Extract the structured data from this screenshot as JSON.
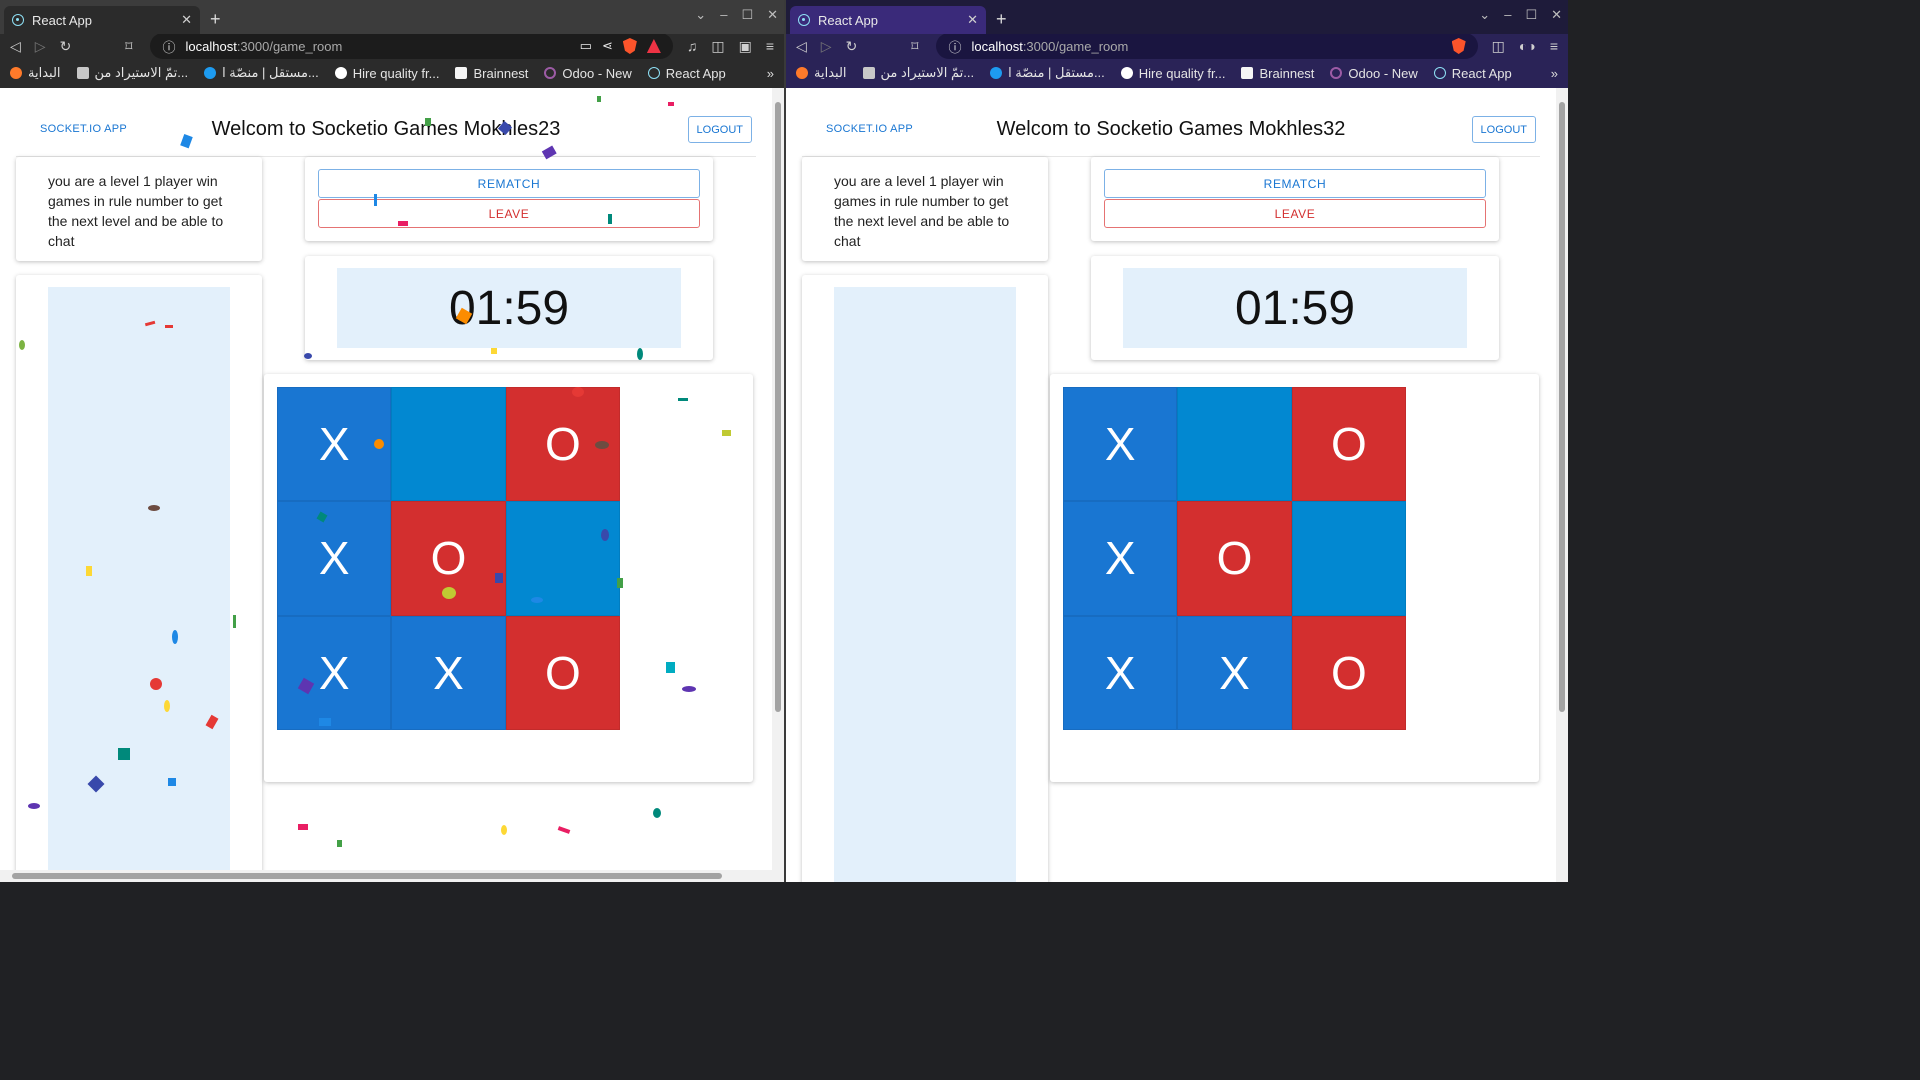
{
  "browser": {
    "tab_title": "React App",
    "tab_close": "✕",
    "new_tab": "+",
    "url_host": "localhost",
    "url_path": ":3000/game_room",
    "bookmarks": [
      "البداية",
      "تمّ الاستيراد من...",
      "مستقل | منصّة ا...",
      "Hire quality fr...",
      "Brainnest",
      "Odoo - New",
      "React App"
    ],
    "more": "»"
  },
  "app": {
    "brand": "SOCKET.IO APP",
    "logout_label": "LOGOUT",
    "info_text": "you are a level 1 player win games in rule number to get the next level and be able to chat",
    "rematch_label": "REMATCH",
    "leave_label": "LEAVE",
    "timer": "01:59"
  },
  "players": {
    "left": {
      "welcome": "Welcom to Socketio Games Mokhles23"
    },
    "right": {
      "welcome": "Welcom to Socketio Games Mokhles32"
    }
  },
  "board": [
    "X",
    "",
    "O",
    "X",
    "O",
    "",
    "X",
    "X",
    "O"
  ],
  "colors": {
    "x_cell": "#1976d2",
    "o_cell": "#d32f2f",
    "empty_cell": "#0288d1",
    "accent": "#1976d2"
  }
}
